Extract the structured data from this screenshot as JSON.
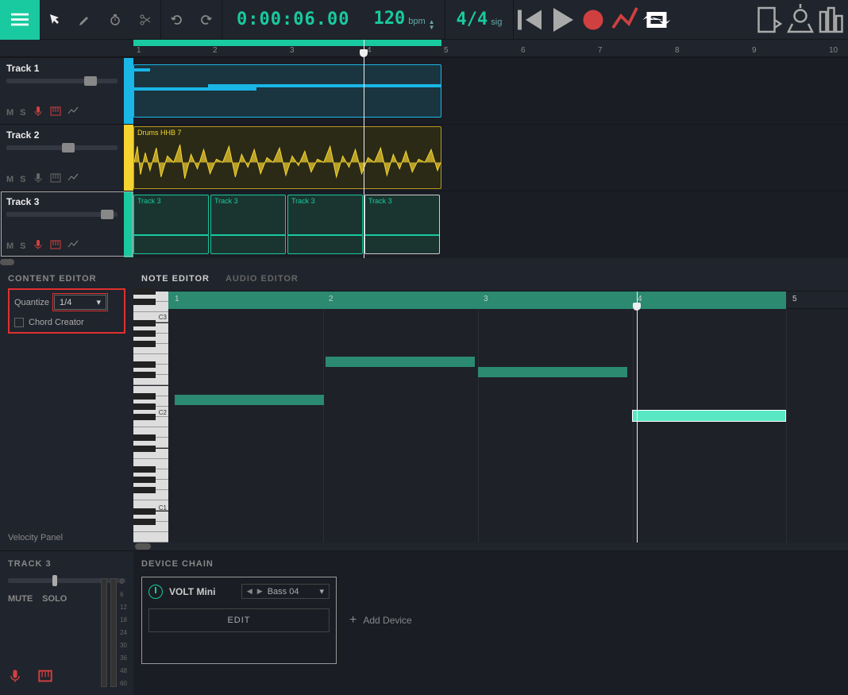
{
  "toolbar": {
    "time": "0:00:06.00",
    "tempo": "120",
    "tempo_unit": "bpm",
    "time_sig": "4/4",
    "time_sig_unit": "sig"
  },
  "tracks": [
    {
      "name": "Track 1",
      "color": "blue",
      "mute": "M",
      "solo": "S"
    },
    {
      "name": "Track 2",
      "color": "yellow",
      "mute": "M",
      "solo": "S",
      "clip_label": "Drums HHB 7"
    },
    {
      "name": "Track 3",
      "color": "teal",
      "mute": "M",
      "solo": "S",
      "clip_label": "Track 3"
    }
  ],
  "ruler_ticks": [
    "1",
    "2",
    "3",
    "4",
    "5",
    "6",
    "7",
    "8",
    "9",
    "10"
  ],
  "content_editor": {
    "title": "CONTENT EDITOR",
    "quantize_label": "Quantize",
    "quantize_value": "1/4",
    "chord_label": "Chord Creator",
    "velocity_label": "Velocity Panel",
    "tabs": {
      "note": "NOTE EDITOR",
      "audio": "AUDIO EDITOR"
    },
    "piano_labels": [
      "C3",
      "C2",
      "C1"
    ],
    "ruler_ticks": [
      "1",
      "2",
      "3",
      "4",
      "5"
    ]
  },
  "device": {
    "side_title": "TRACK 3",
    "mute": "MUTE",
    "solo": "SOLO",
    "main_title": "DEVICE CHAIN",
    "instrument": "VOLT Mini",
    "preset": "Bass 04",
    "edit": "EDIT",
    "add": "Add Device",
    "meter_scale": [
      "0",
      "6",
      "12",
      "18",
      "24",
      "30",
      "36",
      "48",
      "60"
    ]
  }
}
